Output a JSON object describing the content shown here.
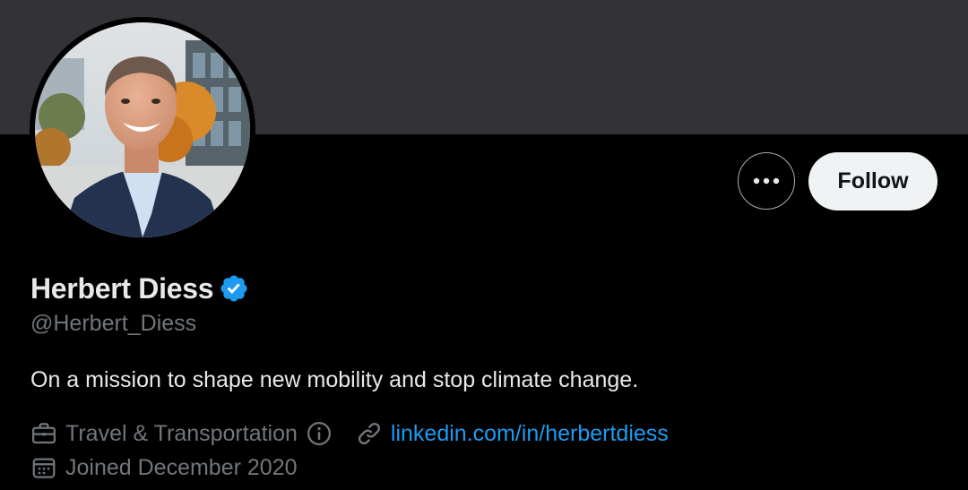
{
  "profile": {
    "display_name": "Herbert Diess",
    "handle": "@Herbert_Diess",
    "bio": "On a mission to shape new mobility and stop climate change.",
    "category": "Travel & Transportation",
    "website": "linkedin.com/in/herbertdiess",
    "joined": "Joined December 2020",
    "verified": true
  },
  "actions": {
    "follow_label": "Follow",
    "more_icon": "more-horizontal-icon"
  },
  "icons": {
    "verified": "verified-badge-icon",
    "category": "briefcase-icon",
    "info": "info-icon",
    "link": "link-icon",
    "joined": "calendar-icon"
  },
  "colors": {
    "background": "#000000",
    "banner": "#333236",
    "primary_text": "#e7e9ea",
    "secondary_text": "#71767b",
    "link": "#1d9bf0",
    "verified": "#1d9bf0",
    "follow_bg": "#eff3f4"
  }
}
